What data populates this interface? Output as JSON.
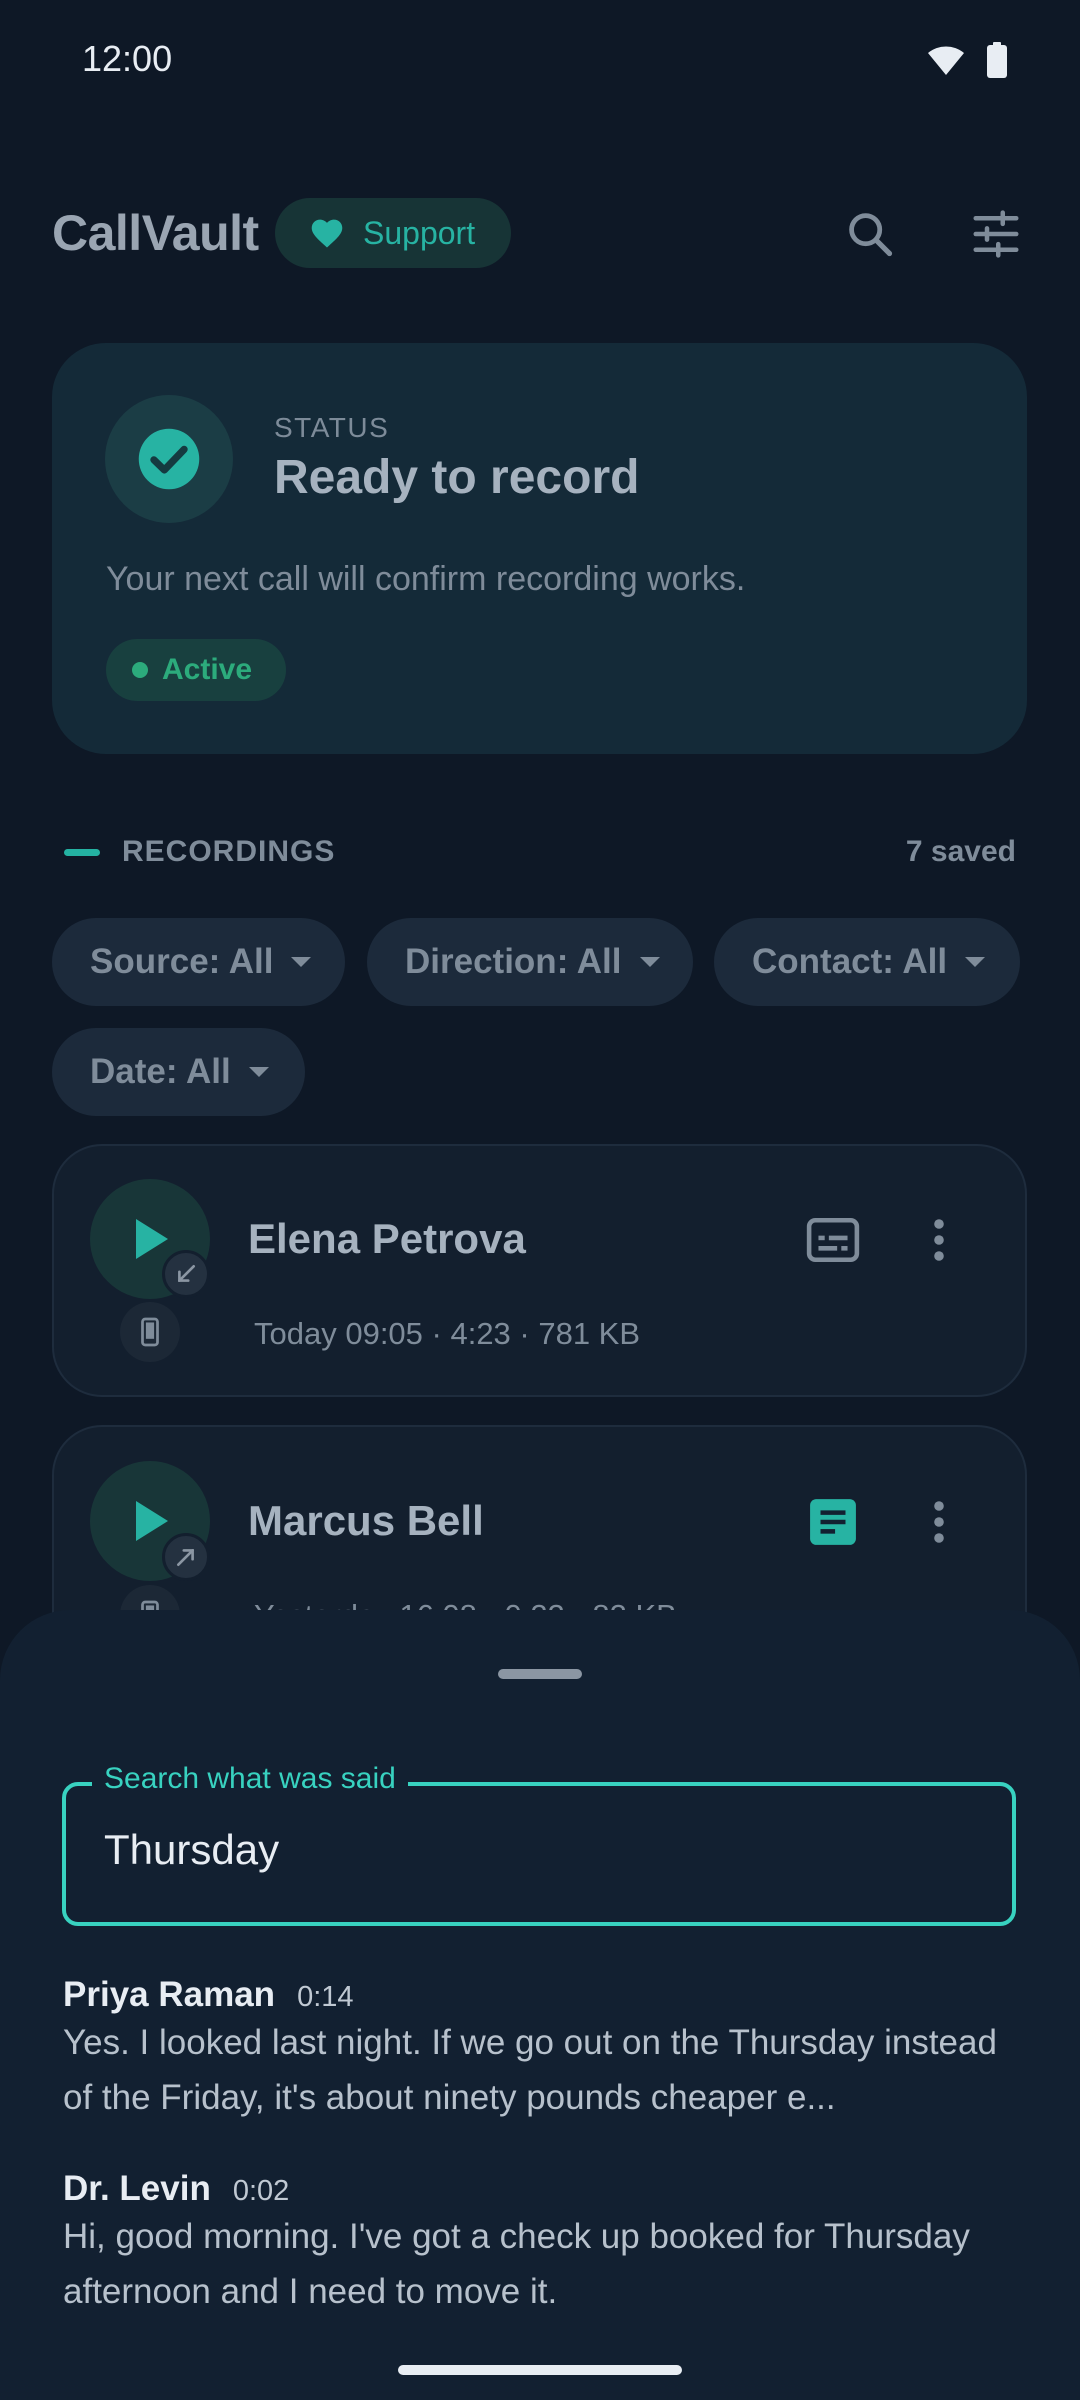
{
  "status_bar": {
    "time": "12:00"
  },
  "header": {
    "app_title": "CallVault",
    "support_label": "Support"
  },
  "status_card": {
    "label": "STATUS",
    "title": "Ready to record",
    "description": "Your next call will confirm recording works.",
    "badge": "Active"
  },
  "recordings": {
    "section_label": "RECORDINGS",
    "count": "7 saved",
    "filters": [
      "Source: All",
      "Direction: All",
      "Contact: All",
      "Date: All"
    ],
    "items": [
      {
        "name": "Elena Petrova",
        "meta": "Today 09:05 · 4:23 · 781 KB"
      },
      {
        "name": "Marcus Bell",
        "meta": "Yesterday 16:08 · 0:22 · 82 KB"
      }
    ]
  },
  "search_sheet": {
    "field_label": "Search what was said",
    "query": "Thursday",
    "results": [
      {
        "speaker": "Priya Raman",
        "time": "0:14",
        "text": "Yes. I looked last night. If we go out on the Thursday instead of the Friday, it's about ninety pounds cheaper e..."
      },
      {
        "speaker": "Dr. Levin",
        "time": "0:02",
        "text": "Hi, good morning. I've got a check up booked for Thursday afternoon and I need to move it."
      }
    ]
  },
  "colors": {
    "accent": "#38d2c0",
    "background": "#0e1826",
    "active": "#2cab7c"
  }
}
